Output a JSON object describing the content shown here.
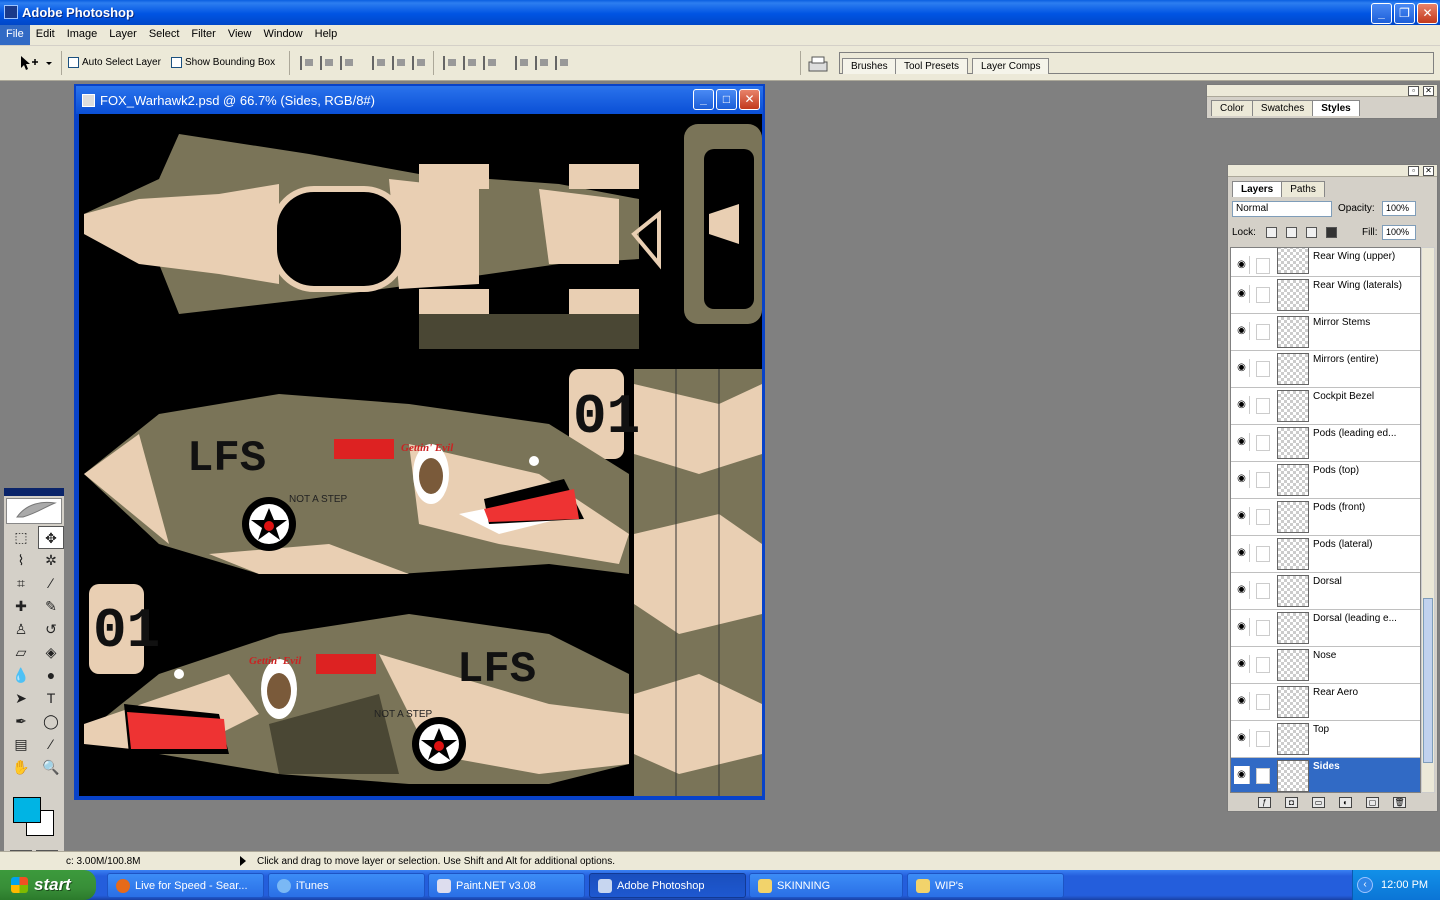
{
  "window": {
    "title": "Adobe Photoshop"
  },
  "menu": [
    "File",
    "Edit",
    "Image",
    "Layer",
    "Select",
    "Filter",
    "View",
    "Window",
    "Help"
  ],
  "options": {
    "auto_select": "Auto Select Layer",
    "bounding_box": "Show Bounding Box",
    "well_tabs": [
      "Brushes",
      "Tool Presets",
      "Layer Comps"
    ]
  },
  "document": {
    "title": "FOX_Warhawk2.psd @ 66.7% (Sides, RGB/8#)",
    "texts": {
      "lfs_top": "LFS",
      "lfs_bottom": "LFS",
      "not_a_step_top": "NOT A STEP",
      "not_a_step_bottom": "NOT A STEP",
      "num_top": "01",
      "num_bottom": "01",
      "gettin_top": "Gettin' Evil",
      "gettin_bottom": "Gettin' Evil"
    }
  },
  "color_panel": {
    "tabs": [
      "Color",
      "Swatches",
      "Styles"
    ]
  },
  "layers_panel": {
    "tabs": [
      "Layers",
      "Paths"
    ],
    "blend_mode": "Normal",
    "opacity_label": "Opacity:",
    "opacity": "100%",
    "lock_label": "Lock:",
    "fill_label": "Fill:",
    "fill": "100%",
    "layers": [
      "Rear Wing (upper)",
      "Rear Wing (laterals)",
      "Mirror Stems",
      "Mirrors (entire)",
      "Cockpit Bezel",
      "Pods (leading ed...",
      "Pods (top)",
      "Pods (front)",
      "Pods (lateral)",
      "Dorsal",
      "Dorsal (leading e...",
      "Nose",
      "Rear Aero",
      "Top",
      "Sides"
    ]
  },
  "status": {
    "doc_size": "c: 3.00M/100.8M",
    "message": "Click and drag to move layer or selection.  Use Shift and Alt for additional options."
  },
  "taskbar": {
    "start": "start",
    "buttons": [
      "Live for Speed - Sear...",
      "iTunes",
      "Paint.NET v3.08",
      "Adobe Photoshop",
      "SKINNING",
      "WIP's"
    ],
    "clock": "12:00 PM"
  },
  "colors": {
    "foreground": "#00b4e4",
    "background": "#ffffff",
    "camo_olive": "#7a7458",
    "camo_tan": "#e9cfb3",
    "xp_blue": "#0054e3"
  }
}
